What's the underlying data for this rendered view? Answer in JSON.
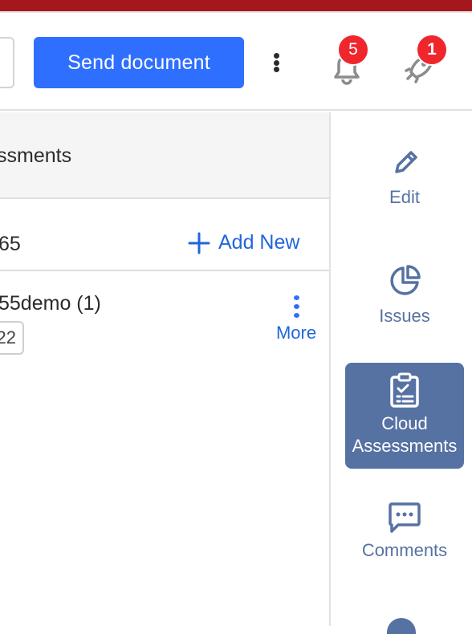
{
  "header": {
    "send_label": "Send document",
    "notifications_count": "5",
    "rocket_count": "1"
  },
  "main": {
    "title": "ssments",
    "row_text": "65",
    "add_new_label": "Add New",
    "item_title": "55demo (1)",
    "item_chip": "22",
    "more_label": "More"
  },
  "rail": {
    "items": [
      {
        "label": "Edit",
        "icon": "pencil-icon"
      },
      {
        "label": "Issues",
        "icon": "pie-chart-icon"
      },
      {
        "label": "Cloud\nAssessments",
        "icon": "clipboard-check-icon",
        "active": true
      },
      {
        "label": "Comments",
        "icon": "message-dots-icon"
      }
    ],
    "active_color": "#5672a3"
  },
  "colors": {
    "accent_bar": "#a4171d",
    "primary": "#2f6fff",
    "link": "#1f66dd",
    "badge": "#f0262d"
  }
}
